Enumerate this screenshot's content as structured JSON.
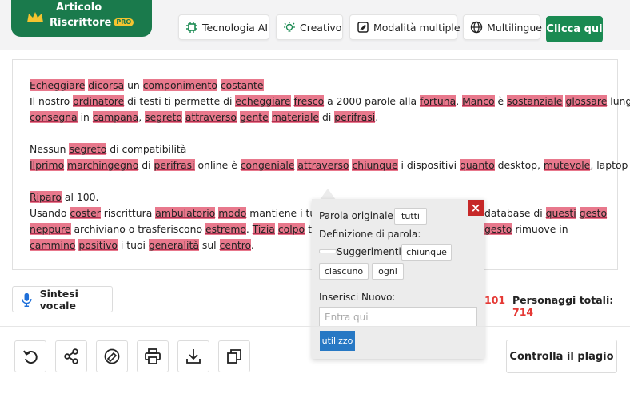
{
  "brand": {
    "line1": "Articolo",
    "line2": "Riscrittore",
    "badge": "PRO",
    "color": "#1a7a4c"
  },
  "features": {
    "ai": "Tecnologia AI",
    "creative": "Creativo",
    "modes": "Modalità multiple",
    "multilang": "Multilingue",
    "cta": "Clicca qui"
  },
  "editor": {
    "highlight_color": "#e8788c",
    "paragraphs": [
      {
        "lines": [
          [
            [
              "Echeggiare",
              true
            ],
            [
              " ",
              false
            ],
            [
              "dicorsa",
              true
            ],
            [
              " un ",
              false
            ],
            [
              "componimento",
              true
            ],
            [
              " ",
              false
            ],
            [
              "costante",
              true
            ]
          ],
          [
            [
              "Il nostro ",
              false
            ],
            [
              "ordinatore",
              true
            ],
            [
              " di testi ti permette di ",
              false
            ],
            [
              "echeggiare",
              true
            ],
            [
              " ",
              false
            ],
            [
              "fresco",
              true
            ],
            [
              " a 2000 parole alla ",
              false
            ],
            [
              "fortuna",
              true
            ],
            [
              ". ",
              false
            ],
            [
              "Manco",
              true
            ],
            [
              " è ",
              false
            ],
            [
              "sostanziale",
              true
            ],
            [
              " ",
              false
            ],
            [
              "glossare",
              true
            ],
            [
              " lunghe",
              false
            ]
          ],
          [
            [
              "consegna",
              true
            ],
            [
              " in ",
              false
            ],
            [
              "campana",
              true
            ],
            [
              ", ",
              false
            ],
            [
              "segreto",
              true
            ],
            [
              " ",
              false
            ],
            [
              "attraverso",
              true
            ],
            [
              " ",
              false
            ],
            [
              "gente",
              true
            ],
            [
              " ",
              false
            ],
            [
              "materiale",
              true
            ],
            [
              " di ",
              false
            ],
            [
              "perifrasi",
              true
            ],
            [
              ".",
              false
            ]
          ]
        ]
      },
      {
        "lines": [
          [
            [
              "Nessun ",
              false
            ],
            [
              "segreto",
              true
            ],
            [
              " di compatibilità",
              false
            ]
          ],
          [
            [
              "Ilprimo",
              true
            ],
            [
              " ",
              false
            ],
            [
              "marchingegno",
              true
            ],
            [
              " di ",
              false
            ],
            [
              "perifrasi",
              true
            ],
            [
              " online è ",
              false
            ],
            [
              "congeniale",
              true
            ],
            [
              " ",
              false
            ],
            [
              "attraverso",
              true
            ],
            [
              " ",
              false
            ],
            [
              "chiunque",
              true
            ],
            [
              " i dispositivi ",
              false
            ],
            [
              "quanto",
              true
            ],
            [
              " desktop, ",
              false
            ],
            [
              "mutevole",
              true
            ],
            [
              ", laptop ecc.",
              false
            ]
          ]
        ]
      },
      {
        "lines": [
          [
            [
              "Riparo",
              true
            ],
            [
              " al 100.",
              false
            ]
          ],
          [
            [
              "Usando ",
              false
            ],
            [
              "coster",
              true
            ],
            [
              " riscrittura ",
              false
            ],
            [
              "ambulatorio",
              true
            ],
            [
              " ",
              false
            ],
            [
              "modo",
              true
            ],
            [
              " mantiene i tuoi ",
              false
            ],
            [
              "terr",
              true
            ]
          ],
          [
            [
              "neppure",
              true
            ],
            [
              " archiviano o trasferiscono ",
              false
            ],
            [
              "estremo",
              true
            ],
            [
              ". ",
              false
            ],
            [
              "Tizia",
              true
            ],
            [
              " ",
              false
            ],
            [
              "colpo",
              true
            ],
            [
              " termina",
              false
            ]
          ],
          [
            [
              "cammino",
              true
            ],
            [
              " ",
              false
            ],
            [
              "positivo",
              true
            ],
            [
              " i tuoi ",
              false
            ],
            [
              "generalità",
              true
            ],
            [
              " sul ",
              false
            ],
            [
              "centro",
              true
            ],
            [
              ".",
              false
            ]
          ]
        ]
      }
    ],
    "right_fragments": [
      [
        [
          "database di ",
          false
        ],
        [
          "questi",
          true
        ],
        [
          " ",
          false
        ],
        [
          "gesto",
          true
        ]
      ],
      [
        [
          "gesto",
          true
        ],
        [
          " rimuove in",
          false
        ]
      ]
    ]
  },
  "popup": {
    "close": "×",
    "original_label": "Parola originale:",
    "original_word": "tutti",
    "definition_label": "Definizione di parola:",
    "suggestions_label": "Suggerimenti:",
    "suggestions": [
      "chiunque",
      "ciascuno",
      "ogni"
    ],
    "insert_label": "Inserisci Nuovo:",
    "insert_placeholder": "Entra qui",
    "use_button": "utilizzo"
  },
  "footer": {
    "tts": "Sintesi vocale",
    "count_partial": "101",
    "total_label": "Personaggi totali:",
    "total_value": "714",
    "plagiarism": "Controlla il plagio"
  },
  "toolbar_icons": [
    "undo-icon",
    "share-icon",
    "erase-icon",
    "print-icon",
    "download-icon",
    "copy-icon"
  ]
}
